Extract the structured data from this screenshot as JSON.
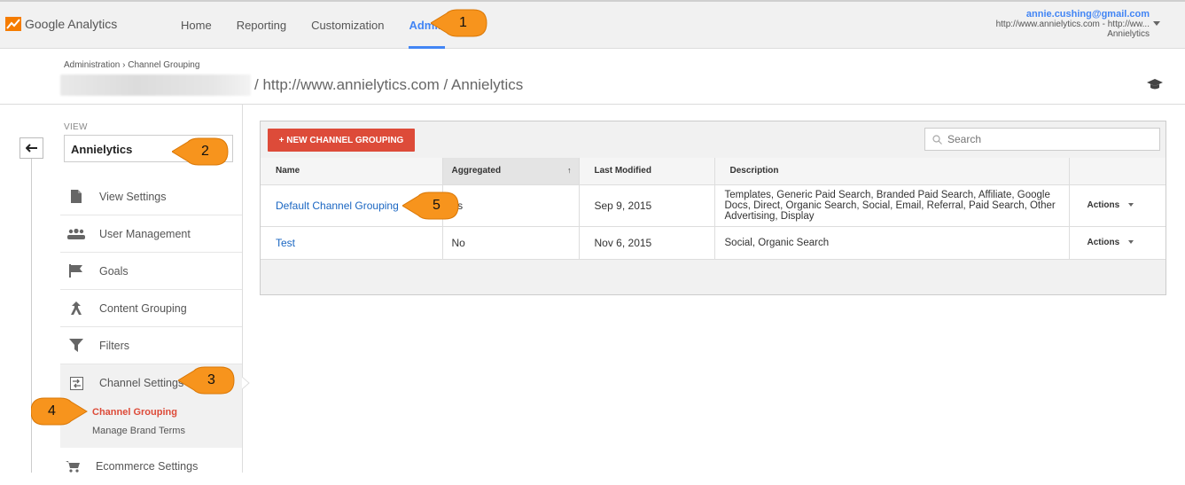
{
  "header": {
    "logo_text": "Google Analytics",
    "nav": [
      "Home",
      "Reporting",
      "Customization",
      "Admin"
    ],
    "active_nav": "Admin",
    "account_email": "annie.cushing@gmail.com",
    "account_property": "http://www.annielytics.com - http://ww...",
    "account_view": "Annielytics"
  },
  "breadcrumb": "Administration › Channel Grouping",
  "page_title": "/ http://www.annielytics.com / Annielytics",
  "sidebar": {
    "view_label": "VIEW",
    "view_value": "Annielytics",
    "items": [
      {
        "label": "View Settings",
        "icon": "document-icon"
      },
      {
        "label": "User Management",
        "icon": "users-icon"
      },
      {
        "label": "Goals",
        "icon": "flag-icon"
      },
      {
        "label": "Content Grouping",
        "icon": "content-grouping-icon"
      },
      {
        "label": "Filters",
        "icon": "filter-icon"
      },
      {
        "label": "Channel Settings",
        "icon": "channel-settings-icon"
      }
    ],
    "sub_items": [
      "Channel Grouping",
      "Manage Brand Terms"
    ],
    "ecommerce_label": "Ecommerce Settings"
  },
  "toolbar": {
    "new_button": "+ NEW CHANNEL GROUPING",
    "search_placeholder": "Search"
  },
  "table": {
    "headers": [
      "Name",
      "Aggregated",
      "Last Modified",
      "Description",
      ""
    ],
    "rows": [
      {
        "name": "Default Channel Grouping",
        "aggregated": "es",
        "last_modified": "Sep 9, 2015",
        "description": "Templates, Generic Paid Search, Branded Paid Search, Affiliate, Google Docs, Direct, Organic Search, Social, Email, Referral, Paid Search, Other Advertising, Display",
        "actions": "Actions"
      },
      {
        "name": "Test",
        "aggregated": "No",
        "last_modified": "Nov 6, 2015",
        "description": "Social, Organic Search",
        "actions": "Actions"
      }
    ]
  },
  "callouts": [
    "1",
    "2",
    "3",
    "4",
    "5"
  ],
  "colors": {
    "accent_blue": "#4285f4",
    "link_blue": "#1a66c2",
    "button_red": "#dd4b39",
    "callout_orange": "#f7941d"
  }
}
